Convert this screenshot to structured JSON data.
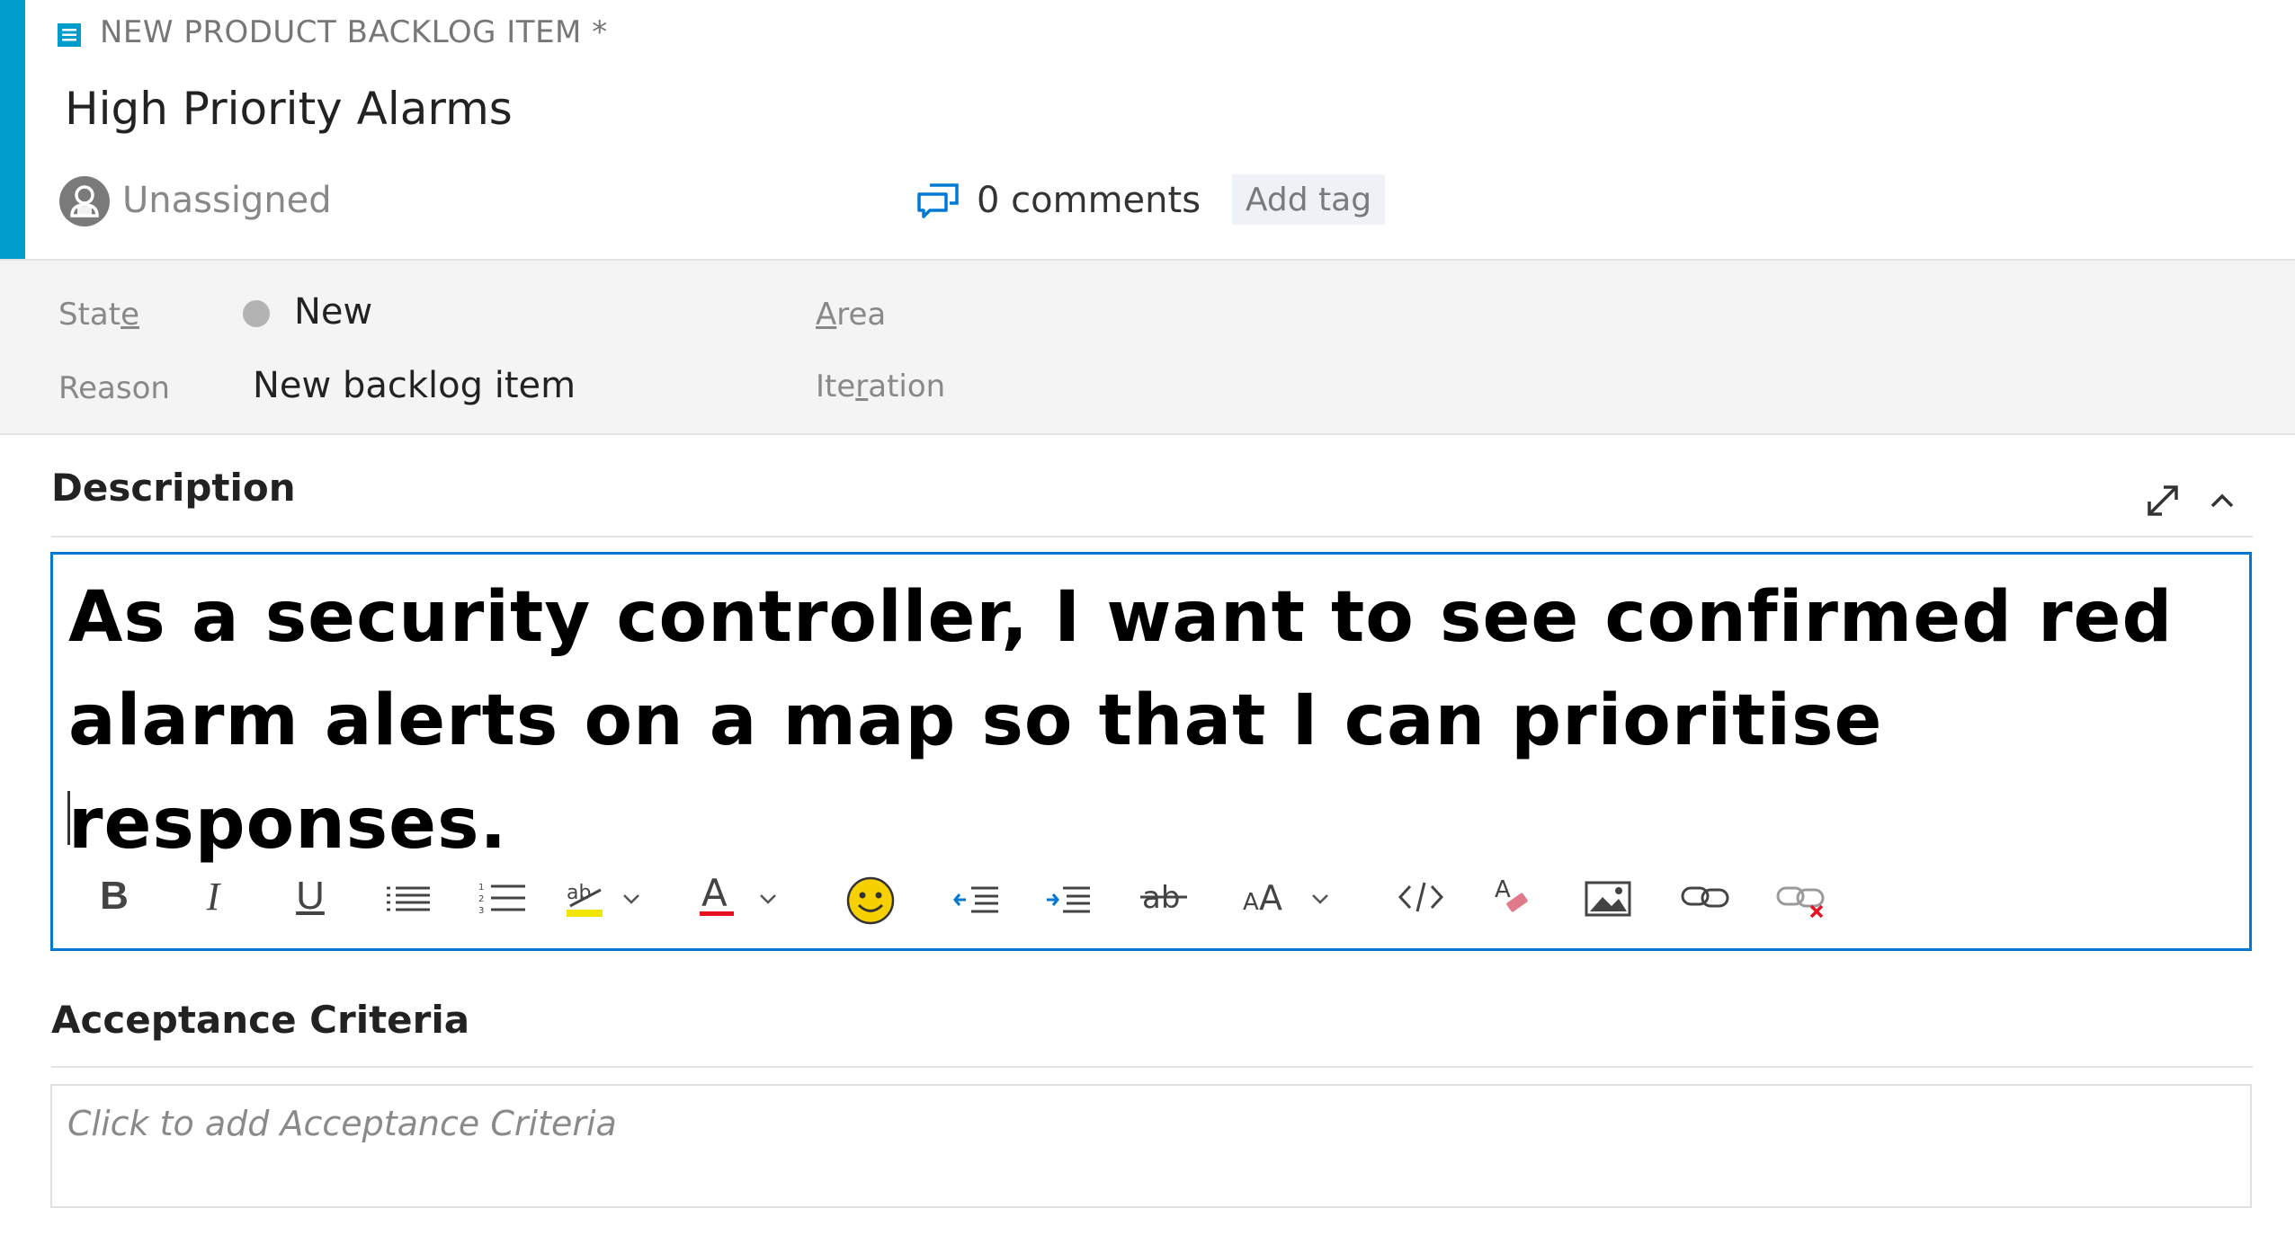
{
  "colors": {
    "accent": "#009ccc",
    "editor_border": "#0078d4",
    "state_dot": "#b3b3b3",
    "tag_bg": "#eef2f6"
  },
  "header": {
    "work_item_type": "NEW PRODUCT BACKLOG ITEM *",
    "type_icon": "backlog-item-icon",
    "title": "High Priority Alarms",
    "assignee": "Unassigned",
    "comments": "0 comments",
    "add_tag": "Add tag"
  },
  "fields": {
    "state_label": "State",
    "state_value": "New",
    "reason_label": "Reason",
    "reason_value": "New backlog item",
    "area_label": "Area",
    "iteration_label": "Iteration"
  },
  "description": {
    "heading": "Description",
    "text": "As a security controller, I want to see confirmed red alarm alerts on a map so that I can prioritise responses.",
    "toolbar": [
      "bold",
      "italic",
      "underline",
      "bullet-list",
      "numbered-list",
      "highlight",
      "font-color",
      "emoji",
      "outdent",
      "indent",
      "strikethrough",
      "font-size",
      "code",
      "clear-format",
      "image",
      "link",
      "unlink"
    ]
  },
  "acceptance_criteria": {
    "heading": "Acceptance Criteria",
    "placeholder": "Click to add Acceptance Criteria"
  }
}
